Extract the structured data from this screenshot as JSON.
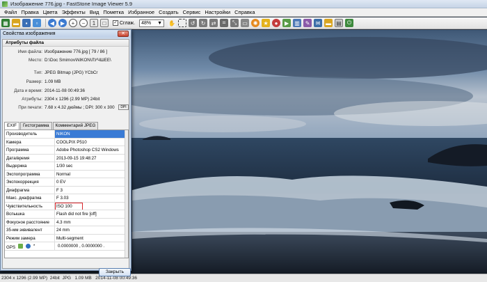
{
  "window": {
    "title": "Изображение 776.jpg  -  FastStone Image Viewer 5.9"
  },
  "menu": [
    "Файл",
    "Правка",
    "Цвета",
    "Эффекты",
    "Вид",
    "Пометка",
    "Избранное",
    "Создать",
    "Сервис",
    "Настройки",
    "Справка"
  ],
  "toolbar": {
    "smooth_label": "Сглаж.",
    "smooth_checked": "✓",
    "zoom_value": "48%",
    "zoom_arrow": "▼"
  },
  "dialog": {
    "title": "Свойства изображения",
    "close_glyph": "✕",
    "group_title": "Атрибуты файла",
    "attributes": [
      {
        "key": "Имя файла:",
        "value": "Изображение 776.jpg  [ 79 / 86 ]"
      },
      {
        "key": "Место:",
        "value": "D:\\Doc Smirnov\\NIKON\\ЛУЧШЕЕ\\"
      },
      {
        "key": "Тип:",
        "value": "JPEG Bitmap (JPG) YCbCr"
      },
      {
        "key": "Размер:",
        "value": "1.09 MB"
      },
      {
        "key": "Дата и время:",
        "value": "2014-11-08 00:49:36"
      },
      {
        "key": "Атрибуты:",
        "value": "2304 x 1296 (2.99 MP)  24bit"
      },
      {
        "key": "При печати:",
        "value": "7.68 x 4.32 дюймы ; DPI: 300 x 300"
      }
    ],
    "dpi_button": "DPI",
    "tabs": [
      "EXIF",
      "Гистограмма",
      "Комментарий JPEG"
    ],
    "exif": [
      {
        "key": "Производитель",
        "value": "NIKON"
      },
      {
        "key": "Камера",
        "value": "COOLPIX P510"
      },
      {
        "key": "Программа",
        "value": "Adobe Photoshop CS2 Windows"
      },
      {
        "key": "Дата/время",
        "value": "2013-09-15 19:48:27"
      },
      {
        "key": "Выдержка",
        "value": "1/30 sec"
      },
      {
        "key": "Экспопрограмма",
        "value": "Normal"
      },
      {
        "key": "Экспокоррекция",
        "value": "0 EV"
      },
      {
        "key": "Диафрагма",
        "value": "F 3"
      },
      {
        "key": "Макс. диафрагма",
        "value": "F 3.03"
      },
      {
        "key": "Чувствительность",
        "value": "ISO 100"
      },
      {
        "key": "Вспышка",
        "value": "Flash did not fire [off]"
      },
      {
        "key": "Фокусное расстояние",
        "value": "4.3 mm"
      },
      {
        "key": "35-мм эквивалент",
        "value": "24 mm"
      },
      {
        "key": "Режим замера",
        "value": "Multi-segment"
      }
    ],
    "gps": {
      "key": "GPS",
      "star": "*",
      "value": "0.0000000  ,  0.0000000 ."
    },
    "close_button": "Закрыть"
  },
  "status": {
    "text": "2304 x 1296 (2.99 MP)  24bit  JPG   1.09 MB   2014-11-08 00:49:36"
  },
  "colors": {
    "selection": "#3a7bd5",
    "highlight_box": "#d8242a",
    "dialog_frame": "#c9d8ea"
  }
}
